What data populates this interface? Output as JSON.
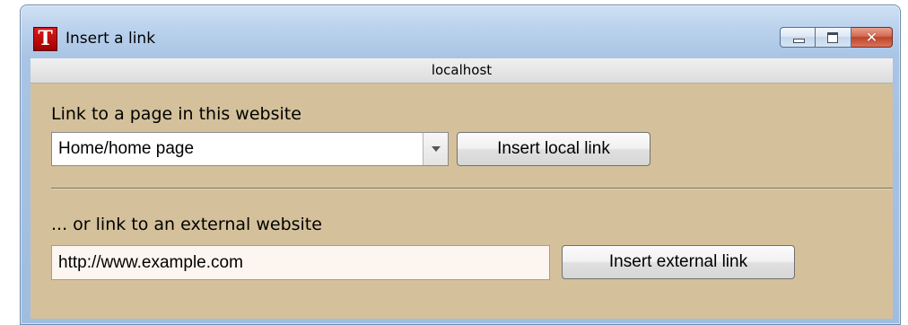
{
  "window": {
    "title": "Insert a link",
    "app_icon_letter": "T",
    "host": "localhost",
    "controls": {
      "minimize": "minimize-icon",
      "maximize": "maximize-icon",
      "close": "close-icon"
    }
  },
  "local": {
    "heading": "Link to a page in this website",
    "selected_page": "Home/home page",
    "button_label": "Insert local link"
  },
  "external": {
    "heading": "... or link to an external website",
    "url_value": "http://www.example.com",
    "button_label": "Insert external link"
  },
  "colors": {
    "content_background": "#d4c19b",
    "url_input_border": "#e0876a",
    "app_icon": "#c41010"
  }
}
